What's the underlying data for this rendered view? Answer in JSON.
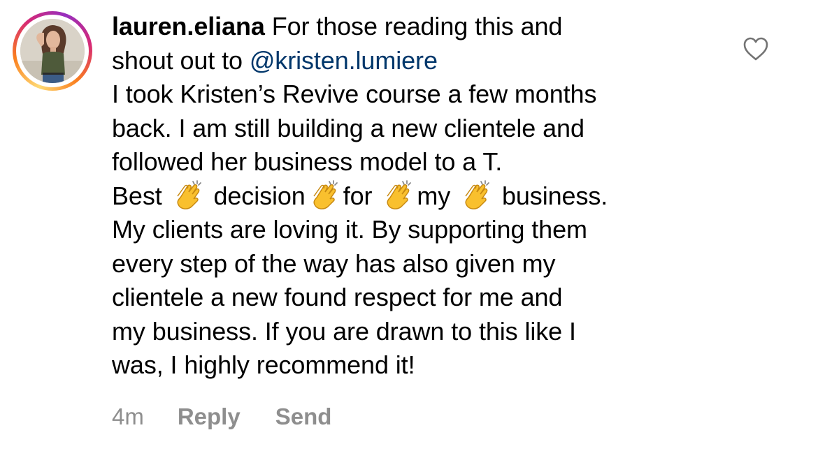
{
  "comment": {
    "username": "lauren.eliana",
    "intro_text": " For those reading this and",
    "shoutout_prefix": "shout out to ",
    "mention": "@kristen.lumiere",
    "body_lines": [
      "I took Kristen’s Revive course a few months",
      "back. I am still building a new clientele and",
      "followed her business model to a T."
    ],
    "emoji_line": {
      "word1": "Best ",
      "word2": " decision",
      "word3": "for ",
      "word4": "my ",
      "word5": " business."
    },
    "closing_lines": [
      "My clients are loving it. By supporting them",
      "every step of the way has also given my",
      "clientele a new found respect for me and",
      "my business. If you are drawn to this like I",
      "was, I highly recommend it!"
    ],
    "timestamp": "4m",
    "reply_label": "Reply",
    "send_label": "Send"
  },
  "icons": {
    "like": "heart-outline-icon",
    "clap": "clapping-hands-emoji"
  },
  "colors": {
    "mention": "#00376b",
    "meta": "#8e8e8e",
    "story_ring": [
      "#feda75",
      "#fa7e1e",
      "#d62976",
      "#962fbf"
    ]
  }
}
